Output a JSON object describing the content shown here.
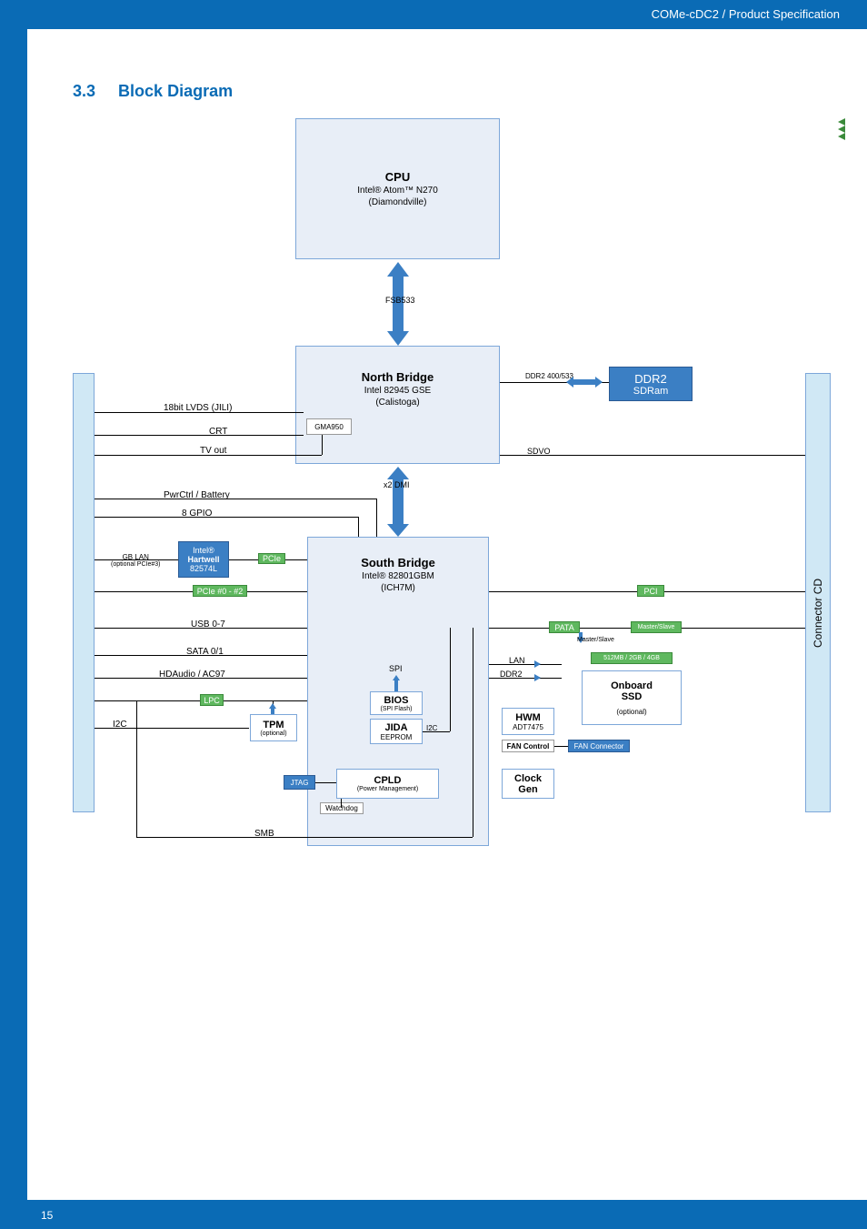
{
  "header": {
    "breadcrumb": "COMe-cDC2 / Product Specification"
  },
  "section": {
    "number": "3.3",
    "title": "Block Diagram"
  },
  "cpu": {
    "title": "CPU",
    "line1": "Intel® Atom™ N270",
    "line2": "(Diamondville)"
  },
  "nb": {
    "title": "North Bridge",
    "line1": "Intel 82945 GSE",
    "line2": "(Calistoga)"
  },
  "sb": {
    "title": "South Bridge",
    "line1": "Intel® 82801GBM",
    "line2": "(ICH7M)"
  },
  "ddr2": {
    "title": "DDR2",
    "sub": "SDRam"
  },
  "onboard_ssd": {
    "title": "Onboard",
    "sub": "SSD",
    "opt": "(optional)"
  },
  "gma": "GMA950",
  "fsb": "FSB533",
  "dmi": "x2 DMI",
  "ddr2_conn": "DDR2 400/533",
  "sdvo": "SDVO",
  "lvds": "18bit LVDS (JILI)",
  "crt": "CRT",
  "tvout": "TV out",
  "pwrctrl": "PwrCtrl / Battery",
  "gpio": "8 GPIO",
  "pcie": "PCIe",
  "pcie02": "PCIe #0 - #2",
  "usb": "USB 0-7",
  "sata": "SATA 0/1",
  "hdaudio": "HDAudio / AC97",
  "lpc": "LPC",
  "i2c": "I2C",
  "smb": "SMB",
  "pci": "PCI",
  "pata": "PATA",
  "master_slave": "Master/Slave",
  "ssd_size": "512MB / 2GB / 4GB",
  "lan": "LAN",
  "ddr2_label": "DDR2",
  "spi": "SPI",
  "gb_lan_phy": {
    "title": "Intel®",
    "line1": "Hartwell",
    "line2": "82574L"
  },
  "gb_lan_label": {
    "l1": "GB LAN",
    "l2": "(optional PCIe#3)"
  },
  "tpm": {
    "title": "TPM",
    "sub": "(optional)"
  },
  "bios": {
    "title": "BIOS",
    "sub": "(SPI Flash)"
  },
  "jida": {
    "title": "JIDA",
    "sub": "EEPROM"
  },
  "cpld": {
    "title": "CPLD",
    "sub": "(Power Management)"
  },
  "watchdog": "Watchdog",
  "jtag": "JTAG",
  "hwm": {
    "title": "HWM",
    "sub": "ADT7475"
  },
  "fan_control": "FAN Control",
  "fan_connector": "FAN Connector",
  "clock": {
    "title": "Clock",
    "sub": "Gen"
  },
  "connector_cd": "Connector CD",
  "footer": {
    "page": "15"
  }
}
